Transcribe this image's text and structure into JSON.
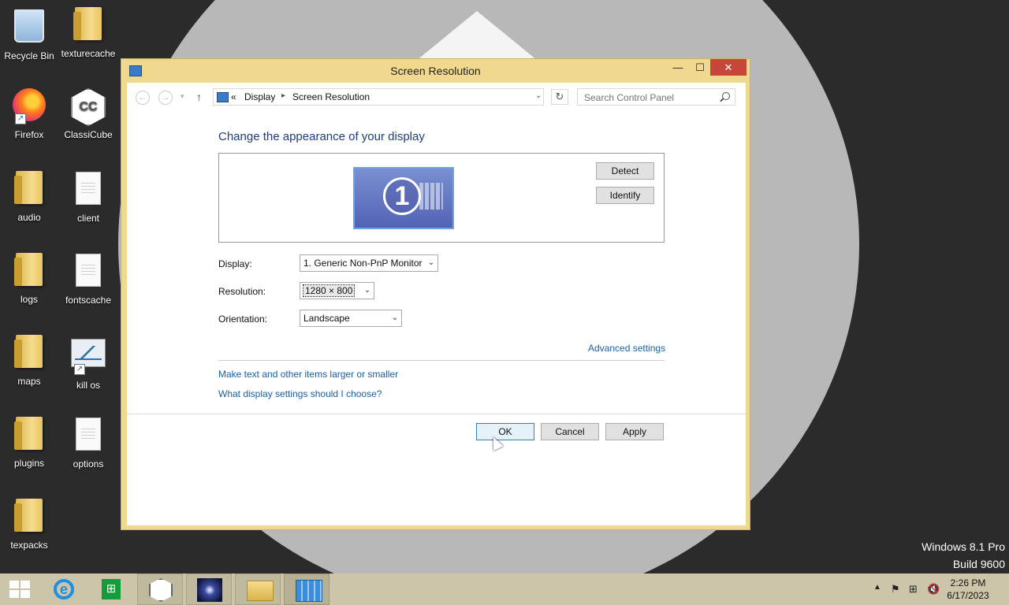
{
  "desktop": {
    "icons": [
      {
        "label": "Recycle Bin",
        "icon": "recycle-bin-icon"
      },
      {
        "label": "texturecache",
        "icon": "folder-icon"
      },
      {
        "label": "Firefox",
        "icon": "firefox-icon"
      },
      {
        "label": "ClassiCube",
        "icon": "classicube-icon"
      },
      {
        "label": "audio",
        "icon": "folder-icon"
      },
      {
        "label": "client",
        "icon": "file-icon"
      },
      {
        "label": "logs",
        "icon": "folder-icon"
      },
      {
        "label": "fontscache",
        "icon": "file-icon"
      },
      {
        "label": "maps",
        "icon": "folder-icon"
      },
      {
        "label": "kill os",
        "icon": "system-monitor-icon"
      },
      {
        "label": "plugins",
        "icon": "folder-icon"
      },
      {
        "label": "options",
        "icon": "file-icon"
      },
      {
        "label": "texpacks",
        "icon": "folder-icon"
      }
    ],
    "watermark": {
      "line1": "Windows 8.1 Pro",
      "line2": "Build 9600"
    }
  },
  "window": {
    "title": "Screen Resolution",
    "controls": {
      "minimize": "—",
      "maximize": "☐",
      "close": "✕"
    },
    "address": {
      "prefix": "«",
      "crumbs": [
        "Display",
        "Screen Resolution"
      ],
      "search_placeholder": "Search Control Panel"
    },
    "heading": "Change the appearance of your display",
    "monitor_number": "1",
    "buttons": {
      "detect": "Detect",
      "identify": "Identify",
      "ok": "OK",
      "cancel": "Cancel",
      "apply": "Apply"
    },
    "fields": {
      "display": {
        "label": "Display:",
        "value": "1. Generic Non-PnP Monitor"
      },
      "resolution": {
        "label": "Resolution:",
        "value": "1280 × 800"
      },
      "orientation": {
        "label": "Orientation:",
        "value": "Landscape"
      }
    },
    "links": {
      "advanced": "Advanced settings",
      "larger_text": "Make text and other items larger or smaller",
      "which_settings": "What display settings should I choose?"
    }
  },
  "taskbar": {
    "apps": [
      "start",
      "internet-explorer",
      "store",
      "classicube",
      "space-image",
      "file-explorer",
      "control-panel"
    ],
    "clock": {
      "time": "2:26 PM",
      "date": "6/17/2023"
    }
  },
  "colors": {
    "accent": "#f0d98e",
    "taskbar": "#ccc5a9",
    "link": "#1a5fa6",
    "heading": "#1e3d7a",
    "close": "#c7463a"
  }
}
